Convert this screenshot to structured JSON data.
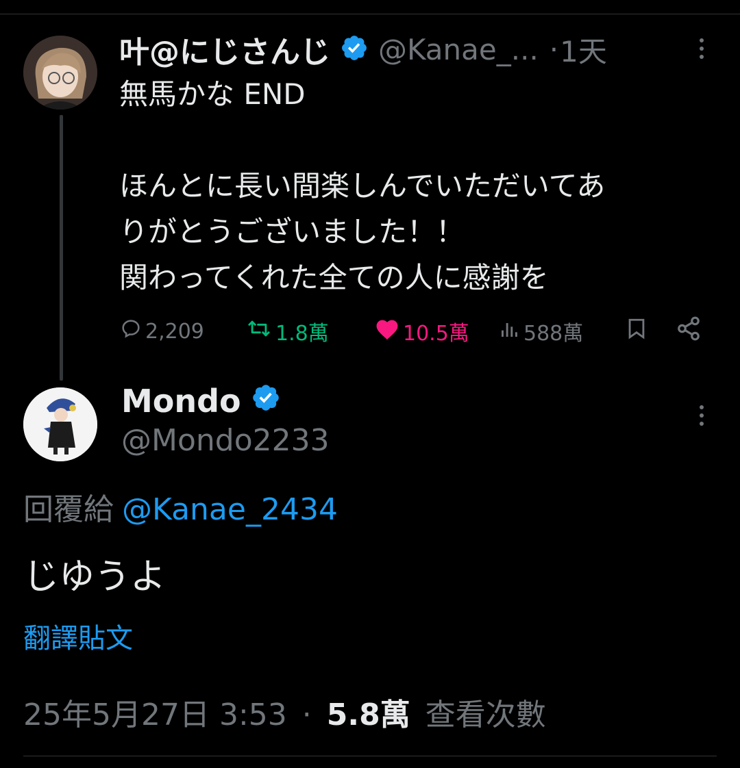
{
  "thread_parent": {
    "author_name": "叶@にじさんじ",
    "handle": "@Kanae_...",
    "separator": "·",
    "time_ago": "1天",
    "text_lines": [
      "無馬かな END",
      "",
      "ほんとに長い間楽しんでいただいてあ",
      "りがとうございました！！",
      "関わってくれた全ての人に感謝を"
    ],
    "stats": {
      "replies": "2,209",
      "retweets": "1.8萬",
      "likes": "10.5萬",
      "views": "588萬"
    }
  },
  "reply": {
    "author_name": "Mondo",
    "handle": "@Mondo2233",
    "reply_prefix": "回覆給",
    "reply_mention": "@Kanae_2434",
    "text": "じゆうよ",
    "translate_label": "翻譯貼文",
    "timestamp": "25年5月27日 3:53",
    "separator": "·",
    "views_count": "5.8萬",
    "views_label": "查看次數"
  },
  "colors": {
    "background": "#000000",
    "primary_text": "#e7e9ea",
    "secondary_text": "#71767b",
    "link": "#1d9bf0",
    "verified": "#1d9bf0",
    "retweet": "#00ba7c",
    "like": "#f91880",
    "divider": "#2f3336"
  },
  "icons": [
    "verified-badge-icon",
    "more-icon",
    "reply-icon",
    "retweet-icon",
    "like-icon",
    "views-icon",
    "bookmark-icon",
    "share-icon"
  ]
}
